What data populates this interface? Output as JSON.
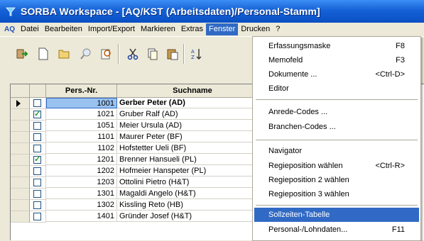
{
  "window": {
    "title": "SORBA Workspace - [AQ/KST (Arbeitsdaten)/Personal-Stamm]"
  },
  "menubar": {
    "logo": "AQ",
    "items": [
      {
        "label": "Datei"
      },
      {
        "label": "Bearbeiten"
      },
      {
        "label": "Import/Export"
      },
      {
        "label": "Markieren"
      },
      {
        "label": "Extras"
      },
      {
        "label": "Fenster"
      },
      {
        "label": "Drucken"
      },
      {
        "label": "?"
      }
    ]
  },
  "toolbar": {
    "icons": [
      "exit-icon",
      "new-document-icon",
      "open-folder-icon",
      "search-icon",
      "find-record-icon",
      "cut-icon",
      "copy-icon",
      "paste-icon",
      "sort-icon"
    ]
  },
  "grid": {
    "columns": [
      {
        "label": "Pers.-Nr."
      },
      {
        "label": "Suchname"
      }
    ],
    "rows": [
      {
        "nr": "1001",
        "name": "Gerber Peter (AD)",
        "checked": false,
        "current": true
      },
      {
        "nr": "1021",
        "name": "Gruber Ralf (AD)",
        "checked": true,
        "current": false
      },
      {
        "nr": "1051",
        "name": "Meier Ursula (AD)",
        "checked": false,
        "current": false
      },
      {
        "nr": "1101",
        "name": "Maurer Peter (BF)",
        "checked": false,
        "current": false
      },
      {
        "nr": "1102",
        "name": "Hofstetter Ueli (BF)",
        "checked": false,
        "current": false
      },
      {
        "nr": "1201",
        "name": "Brenner Hansueli (PL)",
        "checked": true,
        "current": false
      },
      {
        "nr": "1202",
        "name": "Hofmeier Hanspeter (PL)",
        "checked": false,
        "current": false
      },
      {
        "nr": "1203",
        "name": "Ottolini Pietro (H&T)",
        "checked": false,
        "current": false
      },
      {
        "nr": "1301",
        "name": "Magaldi Angelo (H&T)",
        "checked": false,
        "current": false
      },
      {
        "nr": "1302",
        "name": "Kissling Reto (HB)",
        "checked": false,
        "current": false
      },
      {
        "nr": "1401",
        "name": "Gründer Josef (H&T)",
        "checked": false,
        "current": false
      }
    ]
  },
  "fenster_menu": {
    "items": [
      {
        "label": "Erfassungsmaske",
        "shortcut": "F8"
      },
      {
        "label": "Memofeld",
        "shortcut": "F3"
      },
      {
        "label": "Dokumente ...",
        "shortcut": "<Ctrl-D>"
      },
      {
        "label": "Editor",
        "shortcut": ""
      },
      {
        "label": "Anrede-Codes ...",
        "shortcut": ""
      },
      {
        "label": "Branchen-Codes ...",
        "shortcut": ""
      },
      {
        "label": "Navigator",
        "shortcut": ""
      },
      {
        "label": "Regieposition wählen",
        "shortcut": "<Ctrl-R>"
      },
      {
        "label": "Regieposition 2 wählen",
        "shortcut": ""
      },
      {
        "label": "Regieposition 3 wählen",
        "shortcut": ""
      },
      {
        "label": "Sollzeiten-Tabelle",
        "shortcut": ""
      },
      {
        "label": "Personal-/Lohndaten...",
        "shortcut": "F11"
      }
    ]
  },
  "colors": {
    "titlebar": "#1561d6",
    "highlight": "#316ac5",
    "selection": "#99c2f0"
  }
}
